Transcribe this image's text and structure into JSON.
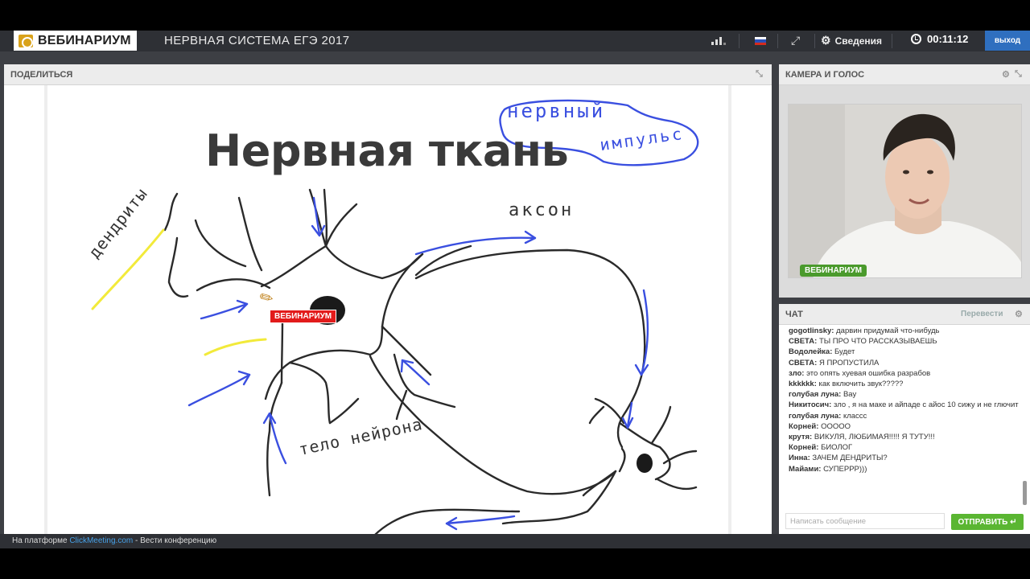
{
  "topbar": {
    "logo_text": "ВЕБИНАРИУМ",
    "title": "НЕРВНАЯ СИСТЕМА  ЕГЭ 2017",
    "info_label": "Сведения",
    "timer": "00:11:12",
    "exit_label": "выход",
    "icons": [
      "signal-icon",
      "russian-flag-icon",
      "fullscreen-icon",
      "gear-icon",
      "clock-icon"
    ]
  },
  "share": {
    "title": "ПОДЕЛИТЬСЯ",
    "whiteboard": {
      "heading": "Нервная ткань",
      "labels": {
        "axon": "аксон",
        "dendrites": "дендриты",
        "cell_body": "тело нейрона",
        "impulse_line1": "нервный",
        "impulse_line2": "импульс"
      },
      "presenter_tag": "ВЕБИНАРИУМ"
    }
  },
  "camera": {
    "title": "КАМЕРА И ГОЛОС",
    "badge": "ВЕБИНАРИУМ"
  },
  "chat": {
    "title": "ЧАТ",
    "translate_label": "Перевести",
    "messages": [
      {
        "author": "gogotlinsky:",
        "text": "дарвин придумай что-нибудь"
      },
      {
        "author": "СВЕТА:",
        "text": "ТЫ ПРО ЧТО РАССКАЗЫВАЕШЬ"
      },
      {
        "author": "Водолейка:",
        "text": "Будет"
      },
      {
        "author": "СВЕТА:",
        "text": "Я ПРОПУСТИЛА"
      },
      {
        "author": "зло:",
        "text": "это опять хуевая ошибка разрабов"
      },
      {
        "author": "kkkkkk:",
        "text": "как включить звук?????"
      },
      {
        "author": "голубая луна:",
        "text": "Вау"
      },
      {
        "author": "Никитосич:",
        "text": "зло , я на маке и айпаде с айос 10 сижу и не глючит"
      },
      {
        "author": "голубая луна:",
        "text": "классс"
      },
      {
        "author": "Корней:",
        "text": "ООООО"
      },
      {
        "author": "крутя:",
        "text": "ВИКУЛЯ, ЛЮБИМАЯ!!!!! Я ТУТУ!!!"
      },
      {
        "author": "Корней:",
        "text": "БИОЛОГ"
      },
      {
        "author": "Инна:",
        "text": "ЗАЧЕМ ДЕНДРИТЫ?"
      },
      {
        "author": "Майами:",
        "text": "СУПЕРРР)))"
      }
    ],
    "input_placeholder": "Написать сообщение",
    "send_label": "ОТПРАВИТЬ ↵"
  },
  "footer": {
    "prefix": "На платформе ",
    "link": "ClickMeeting.com",
    "suffix": " - Вести конференцию"
  }
}
